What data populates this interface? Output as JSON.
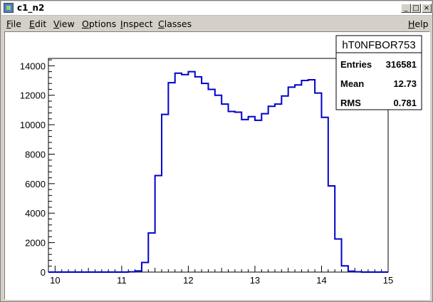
{
  "window": {
    "title": "c1_n2",
    "buttons": [
      "_",
      "□",
      "×"
    ]
  },
  "menu": {
    "items": [
      {
        "label": "File"
      },
      {
        "label": "Edit"
      },
      {
        "label": "View"
      },
      {
        "label": "Options"
      },
      {
        "label": "Inspect"
      },
      {
        "label": "Classes"
      }
    ],
    "help": "Help"
  },
  "stats": {
    "name": "hT0NFBOR753",
    "rows": [
      {
        "label": "Entries",
        "value": "316581"
      },
      {
        "label": "Mean",
        "value": "12.73"
      },
      {
        "label": "RMS",
        "value": "0.781"
      }
    ]
  },
  "chart_data": {
    "type": "histogram",
    "line_color": "#0000cc",
    "xlim": [
      9.9,
      15.0
    ],
    "ylim": [
      0,
      14500
    ],
    "xticks": [
      "10",
      "11",
      "12",
      "13",
      "14",
      "15"
    ],
    "yticks": [
      "0",
      "2000",
      "4000",
      "6000",
      "8000",
      "10000",
      "12000",
      "14000"
    ],
    "bins": {
      "edges_start": 9.9,
      "bin_width": 0.1,
      "values": [
        0,
        0,
        0,
        0,
        0,
        0,
        0,
        0,
        0,
        0,
        0,
        0,
        20,
        80,
        650,
        2650,
        6550,
        10700,
        12850,
        13500,
        13400,
        13600,
        13250,
        12800,
        12400,
        12000,
        11400,
        10900,
        10850,
        10350,
        10550,
        10300,
        10750,
        11250,
        11400,
        11950,
        12550,
        12700,
        13000,
        13050,
        12150,
        10500,
        5850,
        2250,
        420,
        60,
        20,
        0,
        0,
        0,
        0
      ]
    }
  }
}
